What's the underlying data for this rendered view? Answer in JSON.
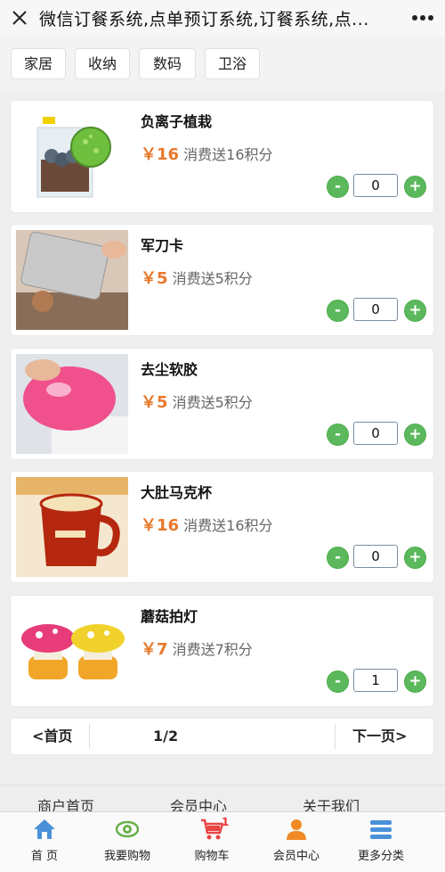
{
  "header": {
    "title": "微信订餐系统,点单预订系统,订餐系统,点..."
  },
  "categories": [
    "家居",
    "收纳",
    "数码",
    "卫浴"
  ],
  "products": [
    {
      "name": "负离子植栽",
      "price": "￥16",
      "points": "消费送16积分",
      "qty": "0"
    },
    {
      "name": "军刀卡",
      "price": "￥5",
      "points": "消费送5积分",
      "qty": "0"
    },
    {
      "name": "去尘软胶",
      "price": "￥5",
      "points": "消费送5积分",
      "qty": "0"
    },
    {
      "name": "大肚马克杯",
      "price": "￥16",
      "points": "消费送16积分",
      "qty": "0"
    },
    {
      "name": "蘑菇拍灯",
      "price": "￥7",
      "points": "消费送7积分",
      "qty": "1"
    }
  ],
  "stepper": {
    "minus": "-",
    "plus": "+"
  },
  "pager": {
    "first": "<首页",
    "page": "1/2",
    "next": "下一页>"
  },
  "footer_links": [
    "商户首页",
    "会员中心",
    "关于我们"
  ],
  "tabs": [
    {
      "label": "首 页",
      "icon": "home-icon"
    },
    {
      "label": "我要购物",
      "icon": "eye-icon"
    },
    {
      "label": "购物车",
      "icon": "cart-icon",
      "badge": "1"
    },
    {
      "label": "会员中心",
      "icon": "user-icon"
    },
    {
      "label": "更多分类",
      "icon": "menu-icon"
    }
  ],
  "colors": {
    "price": "#e8792b",
    "stepper": "#5cb85c",
    "tab_icon": "#4a90d9"
  }
}
